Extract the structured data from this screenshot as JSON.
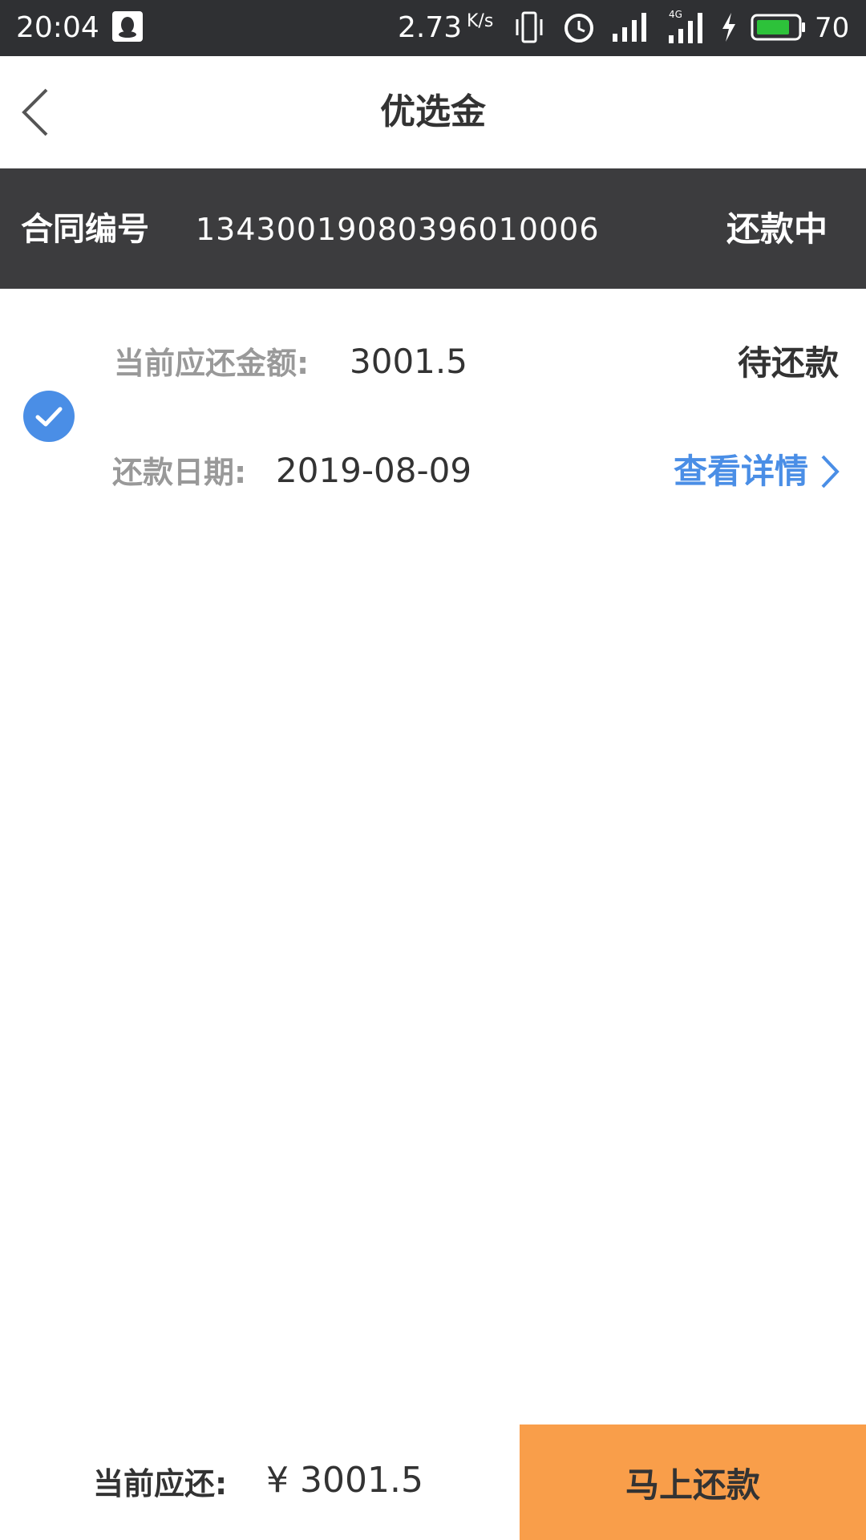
{
  "status_bar": {
    "time": "20:04",
    "network_speed": "2.73",
    "speed_unit": "K/s",
    "battery_level": "70",
    "network_type": "4G"
  },
  "header": {
    "title": "优选金",
    "back_icon": "chevron-left-icon"
  },
  "contract": {
    "label": "合同编号",
    "number": "13430019080396010006",
    "status": "还款中",
    "bar_color": "#3c3c3e"
  },
  "repayment_item": {
    "checked": true,
    "check_color": "#4a8ee6",
    "amount_label": "当前应还金额:",
    "amount_value": "3001.5",
    "status": "待还款",
    "date_label": "还款日期:",
    "date_value": "2019-08-09",
    "detail_link": "查看详情",
    "link_color": "#4a8ee6"
  },
  "bottom": {
    "label": "当前应还:",
    "amount": "¥ 3001.5",
    "pay_button_label": "马上还款",
    "pay_button_color": "#f99e4a"
  }
}
